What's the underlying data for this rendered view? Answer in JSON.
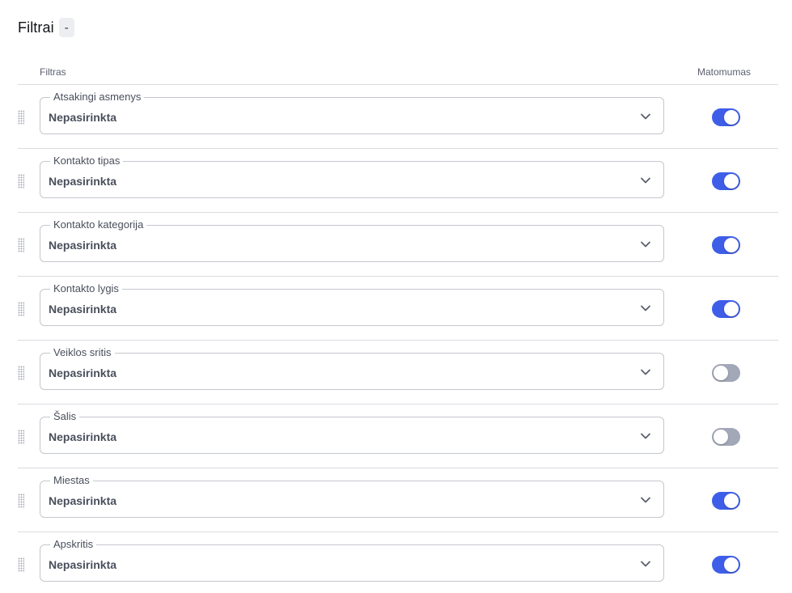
{
  "header": {
    "title": "Filtrai",
    "collapse_label": "-"
  },
  "table": {
    "columns": {
      "filter": "Filtras",
      "visibility": "Matomumas"
    },
    "rows": [
      {
        "label": "Atsakingi asmenys",
        "value": "Nepasirinkta",
        "visible": true
      },
      {
        "label": "Kontakto tipas",
        "value": "Nepasirinkta",
        "visible": true
      },
      {
        "label": "Kontakto kategorija",
        "value": "Nepasirinkta",
        "visible": true
      },
      {
        "label": "Kontakto lygis",
        "value": "Nepasirinkta",
        "visible": true
      },
      {
        "label": "Veiklos sritis",
        "value": "Nepasirinkta",
        "visible": false
      },
      {
        "label": "Šalis",
        "value": "Nepasirinkta",
        "visible": false
      },
      {
        "label": "Miestas",
        "value": "Nepasirinkta",
        "visible": true
      },
      {
        "label": "Apskritis",
        "value": "Nepasirinkta",
        "visible": true
      }
    ]
  },
  "colors": {
    "toggle_on": "#3f5ee8",
    "toggle_off": "#a3a8b8"
  },
  "icons": {
    "drag": "drag-handle-icon",
    "dropdown": "chevron-down-icon"
  }
}
